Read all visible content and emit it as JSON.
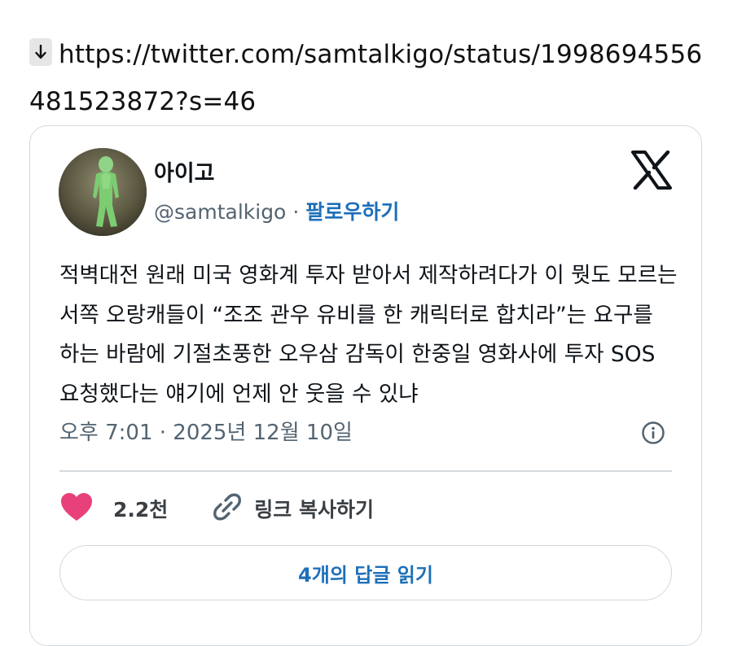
{
  "link": {
    "url": "https://twitter.com/samtalkigo/status/1998694556481523872?s=46",
    "icon": "download-arrow-icon"
  },
  "tweet": {
    "display_name": "아이고",
    "handle": "@samtalkigo",
    "separator": "·",
    "follow_label": "팔로우하기",
    "logo_icon": "x-logo-icon",
    "text": "적벽대전 원래 미국 영화계 투자 받아서 제작하려다가 이 뭣도 모르는 서쪽 오랑캐들이 “조조 관우 유비를 한 캐릭터로 합치라”는 요구를 하는 바람에 기절초풍한 오우삼 감독이 한중일 영화사에 투자 SOS 요청했다는 얘기에 언제 안 웃을 수 있냐",
    "timestamp": "오후 7:01 · 2025년 12월 10일",
    "info_icon": "info-icon",
    "like_icon": "heart-icon",
    "like_count": "2.2천",
    "copy_icon": "link-icon",
    "copy_label": "링크 복사하기",
    "replies_label": "4개의 답글 읽기"
  },
  "colors": {
    "link_blue": "#1d6fb8",
    "heart_pink": "#e8407a",
    "muted_text": "#536471",
    "border": "#d6d9dc"
  }
}
